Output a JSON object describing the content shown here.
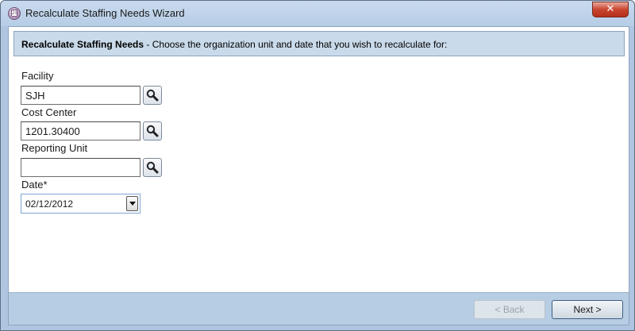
{
  "window": {
    "title": "Recalculate Staffing Needs Wizard",
    "icon": "calendar-icon",
    "icon_text": "28",
    "close_glyph": "✕"
  },
  "header": {
    "title": "Recalculate Staffing Needs",
    "description": " - Choose the organization unit and date that you wish to recalculate for:"
  },
  "form": {
    "facility": {
      "label": "Facility",
      "value": "SJH"
    },
    "cost_center": {
      "label": "Cost Center",
      "value": "1201.30400"
    },
    "reporting_unit": {
      "label": "Reporting Unit",
      "value": ""
    },
    "date": {
      "label": "Date*",
      "value": "02/12/2012"
    }
  },
  "footer": {
    "back_label": "< Back",
    "next_label": "Next >"
  },
  "colors": {
    "header_band": "#c9daea",
    "footer_band": "#b7cde3",
    "close_red": "#c9452f"
  }
}
